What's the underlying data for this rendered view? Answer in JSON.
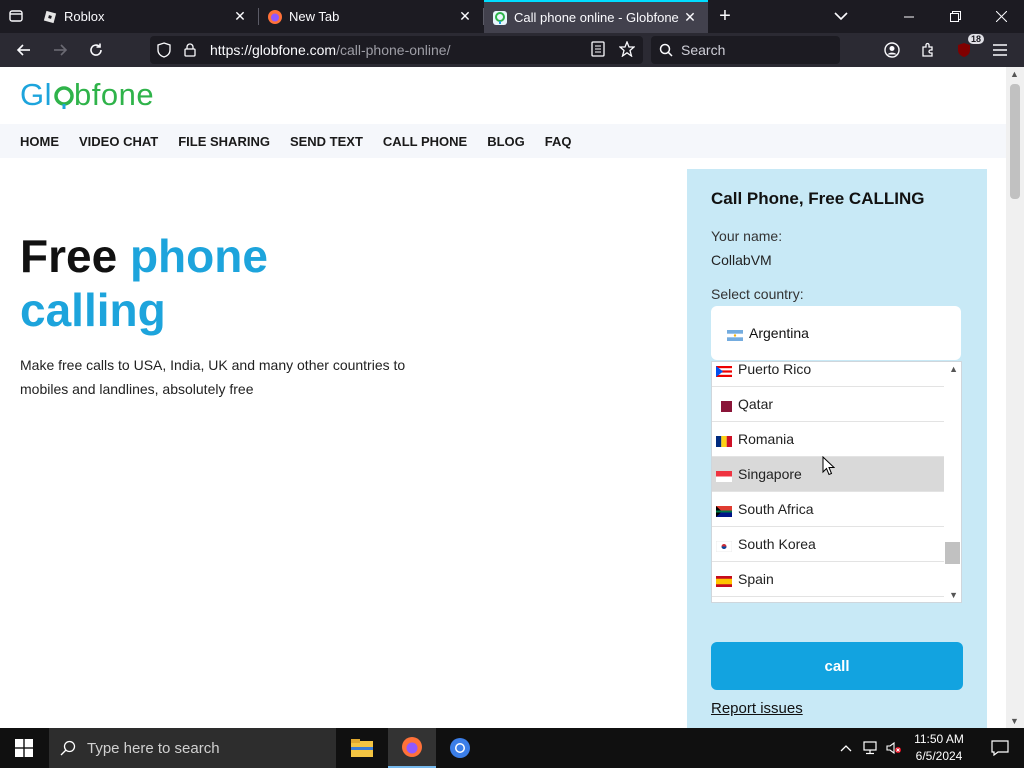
{
  "browser": {
    "tabs": [
      {
        "title": "Roblox",
        "icon": "roblox-icon"
      },
      {
        "title": "New Tab",
        "icon": "firefox-icon"
      },
      {
        "title": "Call phone online - Globfone | F",
        "icon": "globfone-icon",
        "active": true
      }
    ],
    "url_host": "https://globfone.com",
    "url_path": "/call-phone-online/",
    "search_placeholder": "Search",
    "notification_count": "18"
  },
  "site": {
    "logo": "Globfone",
    "menu": [
      "HOME",
      "VIDEO CHAT",
      "FILE SHARING",
      "SEND TEXT",
      "CALL PHONE",
      "BLOG",
      "FAQ"
    ],
    "hero": {
      "title_part1": "Free",
      "title_part2": "phone",
      "title_part3": "calling",
      "description": "Make free calls to USA, India, UK and many other countries to mobiles and landlines, absolutely free"
    },
    "panel": {
      "title": "Call Phone, Free CALLING",
      "name_label": "Your name:",
      "name_value": "CollabVM",
      "country_label": "Select country:",
      "selected_country": "Argentina",
      "options": [
        "Puerto Rico",
        "Qatar",
        "Romania",
        "Singapore",
        "South Africa",
        "South Korea",
        "Spain"
      ],
      "hovered_option": "Singapore",
      "call_button": "call",
      "report_link": "Report issues"
    }
  },
  "taskbar": {
    "search_placeholder": "Type here to search",
    "time": "11:50 AM",
    "date": "6/5/2024"
  },
  "colors": {
    "accent": "#1da4dc",
    "panel_bg": "#c8e9f6",
    "call_button": "#12a3e0",
    "logo_green": "#2fb34a"
  }
}
